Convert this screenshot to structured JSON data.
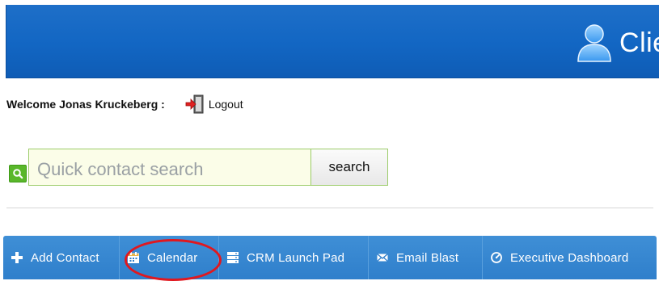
{
  "header": {
    "brand_title": "Clien",
    "brand_icon": "user-icon",
    "background": "#1266c3"
  },
  "welcome": {
    "text": "Welcome Jonas Kruckeberg :",
    "logout_label": "Logout",
    "logout_icon": "logout-door-icon"
  },
  "search": {
    "placeholder": "Quick contact search",
    "value": "",
    "button_label": "search",
    "icon": "search-q-icon",
    "accent": "#59b72a"
  },
  "nav": {
    "background": "#2f7fcb",
    "items": [
      {
        "label": "Add Contact",
        "icon": "plus-icon"
      },
      {
        "label": "Calendar",
        "icon": "calendar-icon"
      },
      {
        "label": "CRM Launch Pad",
        "icon": "list-icon"
      },
      {
        "label": "Email Blast",
        "icon": "envelope-icon"
      },
      {
        "label": "Executive Dashboard",
        "icon": "dashboard-gauge-icon"
      }
    ]
  },
  "annotation": {
    "color": "#e0181f",
    "target": "Calendar"
  }
}
